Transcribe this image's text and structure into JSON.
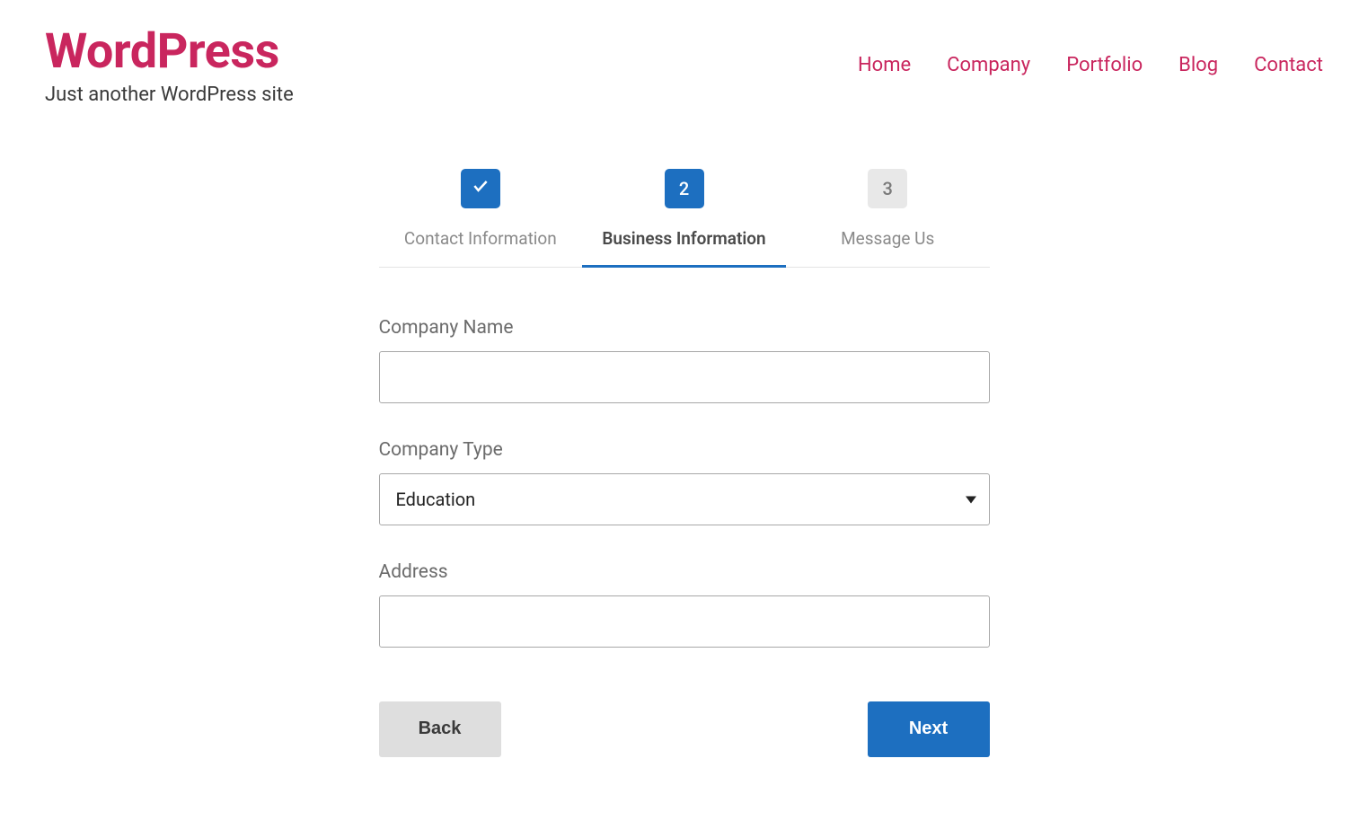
{
  "site": {
    "title": "WordPress",
    "tagline": "Just another WordPress site"
  },
  "nav": {
    "items": [
      "Home",
      "Company",
      "Portfolio",
      "Blog",
      "Contact"
    ]
  },
  "steps": [
    {
      "label": "Contact Information",
      "indicator": "check",
      "state": "complete"
    },
    {
      "label": "Business Information",
      "indicator": "2",
      "state": "active"
    },
    {
      "label": "Message Us",
      "indicator": "3",
      "state": "inactive"
    }
  ],
  "form": {
    "company_name": {
      "label": "Company Name",
      "value": ""
    },
    "company_type": {
      "label": "Company Type",
      "selected": "Education"
    },
    "address": {
      "label": "Address",
      "value": ""
    }
  },
  "buttons": {
    "back": "Back",
    "next": "Next"
  }
}
